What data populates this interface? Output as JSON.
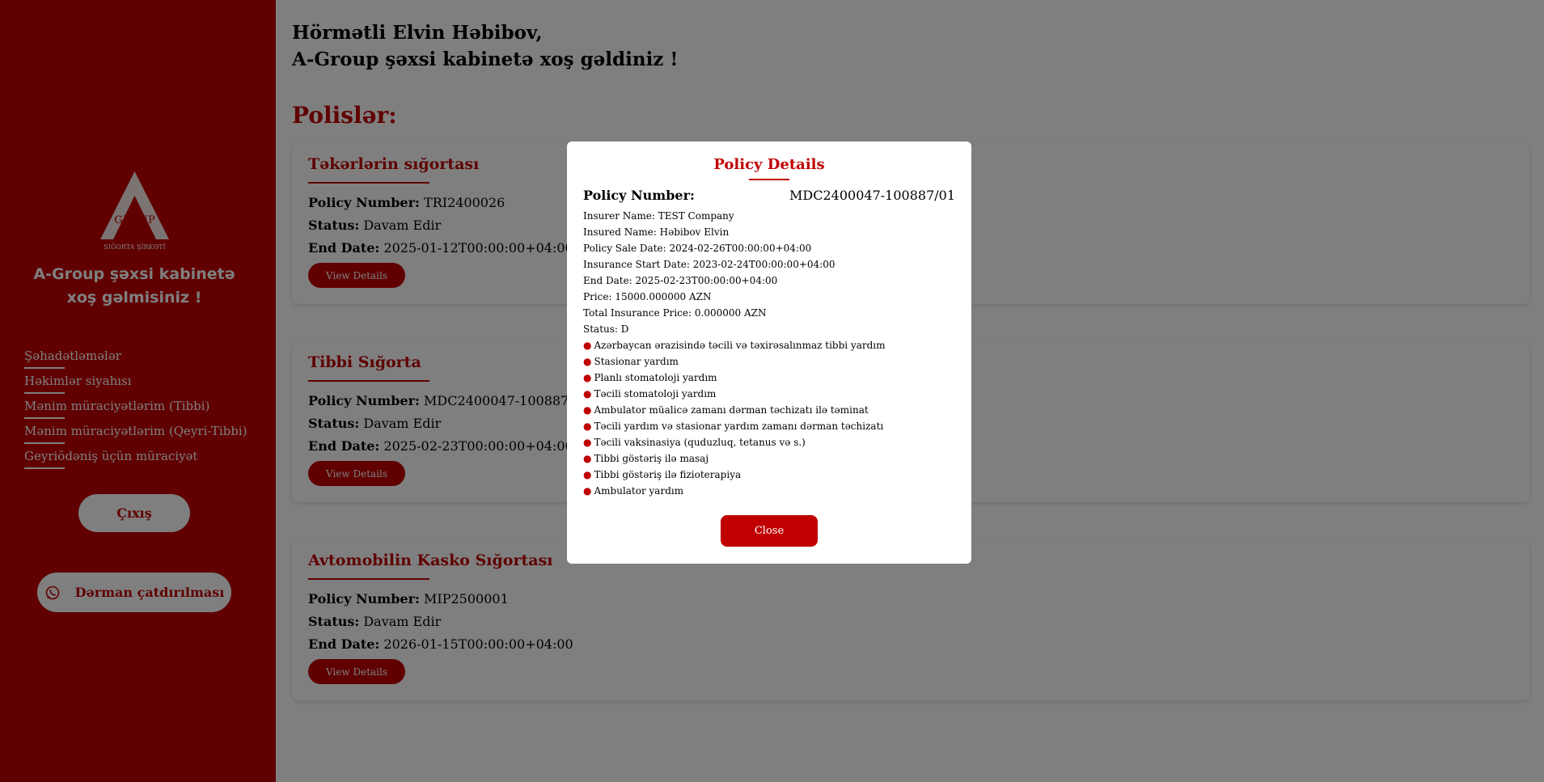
{
  "colors": {
    "brand_red": "#c00000",
    "overlay": "rgba(0,0,0,0.5)"
  },
  "sidebar": {
    "logo": {
      "name": "a-group-logo",
      "text_main": "GROUP",
      "text_sub": "SIĞORTA ŞİRKƏTİ"
    },
    "welcome": "A-Group şəxsi kabinetə xoş gəlmisiniz !",
    "nav": [
      {
        "label": "Şəhadətləmələr"
      },
      {
        "label": "Həkimlər siyahısı"
      },
      {
        "label": "Mənim müraciyətlərim (Tibbi)"
      },
      {
        "label": "Mənim müraciyətlərim (Qeyri-Tibbi)"
      },
      {
        "label": "Geyriödəniş üçün müraciyət"
      }
    ],
    "logout_label": "Çıxış",
    "delivery_label": "Dərman çatdırılması",
    "delivery_icon": "whatsapp-icon"
  },
  "main": {
    "greeting_line1": "Hörmətli Elvin Həbibov,",
    "greeting_line2": "A-Group şəxsi kabinetə xoş gəldiniz !",
    "section_title": "Polislər:",
    "policy_number_label": "Policy Number:",
    "status_label": "Status:",
    "end_date_label": "End Date:",
    "view_details_label": "View Details",
    "cards": [
      {
        "title": "Təkərlərin sığortası",
        "policy_number": "TRI2400026",
        "status": "Davam Edir",
        "end_date": "2025-01-12T00:00:00+04:00"
      },
      {
        "title": "Tibbi Sığorta",
        "policy_number": "MDC2400047-100887/01",
        "status": "Davam Edir",
        "end_date": "2025-02-23T00:00:00+04:00"
      },
      {
        "title": "Avtomobilin Kasko Sığortası",
        "policy_number": "MIP2500001",
        "status": "Davam Edir",
        "end_date": "2026-01-15T00:00:00+04:00"
      }
    ]
  },
  "modal": {
    "title": "Policy Details",
    "policy_number_label": "Policy Number:",
    "policy_number": "MDC2400047-100887/01",
    "details": [
      "Insurer Name: TEST Company",
      "Insured Name: Həbibov Elvin",
      "Policy Sale Date: 2024-02-26T00:00:00+04:00",
      "Insurance Start Date: 2023-02-24T00:00:00+04:00",
      "End Date: 2025-02-23T00:00:00+04:00",
      "Price: 15000.000000 AZN",
      "Total Insurance Price: 0.000000 AZN",
      "Status: D"
    ],
    "bullet_char": "●",
    "coverages": [
      "Azərbaycan ərazisində təcili və təxirəsalınmaz tibbi yardım",
      "Stasionar yardım",
      "Planlı stomatoloji yardım",
      "Təcili stomatoloji yardım",
      "Ambulator müalicə zamanı dərman təchizatı ilə təminat",
      "Təcili yardım və stasionar yardım zamanı dərman təchizatı",
      "Təcili vaksinasiya (quduzluq, tetanus və s.)",
      "Tibbi göstəriş ilə masaj",
      "Tibbi göstəriş ilə fizioterapiya",
      "Ambulator yardım"
    ],
    "close_label": "Close"
  }
}
